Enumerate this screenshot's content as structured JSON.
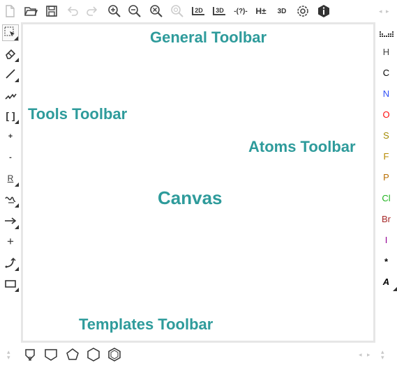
{
  "labels": {
    "general": "General Toolbar",
    "tools": "Tools Toolbar",
    "atoms": "Atoms Toolbar",
    "canvas": "Canvas",
    "templates": "Templates Toolbar"
  },
  "top_toolbar": {
    "buttons": [
      {
        "icon": "new-file-icon"
      },
      {
        "icon": "open-folder-icon"
      },
      {
        "icon": "save-icon"
      },
      {
        "icon": "undo-icon"
      },
      {
        "icon": "redo-icon"
      },
      {
        "icon": "zoom-in-icon"
      },
      {
        "icon": "zoom-out-icon"
      },
      {
        "icon": "zoom-reset-icon"
      },
      {
        "icon": "zoom-disabled-icon"
      },
      {
        "icon": "clean-2d-icon",
        "text": "2D"
      },
      {
        "icon": "clean-3d-icon",
        "text": "3D"
      },
      {
        "icon": "check-icon",
        "text": "-(?)-"
      },
      {
        "icon": "explicit-hydrogens-icon",
        "text": "H±"
      },
      {
        "icon": "3d-viewer-icon",
        "text": "3D"
      },
      {
        "icon": "settings-icon"
      },
      {
        "icon": "info-icon"
      }
    ]
  },
  "left_toolbar": {
    "tools": [
      {
        "icon": "select-icon",
        "selected": true
      },
      {
        "icon": "eraser-icon"
      },
      {
        "icon": "bond-icon"
      },
      {
        "icon": "chain-icon"
      },
      {
        "icon": "bracket-icon",
        "text": "[ ]"
      },
      {
        "icon": "charge-plus-icon",
        "text": "+"
      },
      {
        "icon": "charge-minus-icon",
        "text": "-"
      },
      {
        "icon": "rgroup-icon",
        "text": "R"
      },
      {
        "icon": "reaction-mapping-icon"
      },
      {
        "icon": "reaction-arrow-icon"
      },
      {
        "icon": "reaction-plus-icon",
        "text": "+"
      },
      {
        "icon": "rotate-icon"
      },
      {
        "icon": "shape-rectangle-icon"
      }
    ]
  },
  "right_toolbar": {
    "periodic_icon": "periodic-table-icon",
    "atoms": [
      {
        "symbol": "H",
        "color": "#404040"
      },
      {
        "symbol": "C",
        "color": "#000000"
      },
      {
        "symbol": "N",
        "color": "#304ff7"
      },
      {
        "symbol": "O",
        "color": "#ff0d0d"
      },
      {
        "symbol": "S",
        "color": "#a38a00"
      },
      {
        "symbol": "F",
        "color": "#b88a00"
      },
      {
        "symbol": "P",
        "color": "#b86e00"
      },
      {
        "symbol": "Cl",
        "color": "#1fb31f"
      },
      {
        "symbol": "Br",
        "color": "#a62929"
      },
      {
        "symbol": "I",
        "color": "#940094"
      },
      {
        "symbol": "*",
        "color": "#000000"
      },
      {
        "symbol": "A",
        "color": "#000000"
      }
    ]
  },
  "bottom_toolbar": {
    "templates": [
      {
        "icon": "template-benzene-icon"
      },
      {
        "icon": "template-shield-icon"
      },
      {
        "icon": "template-pentagon-icon"
      },
      {
        "icon": "template-hexagon-icon"
      },
      {
        "icon": "template-hexagon-aromatic-icon"
      }
    ]
  }
}
